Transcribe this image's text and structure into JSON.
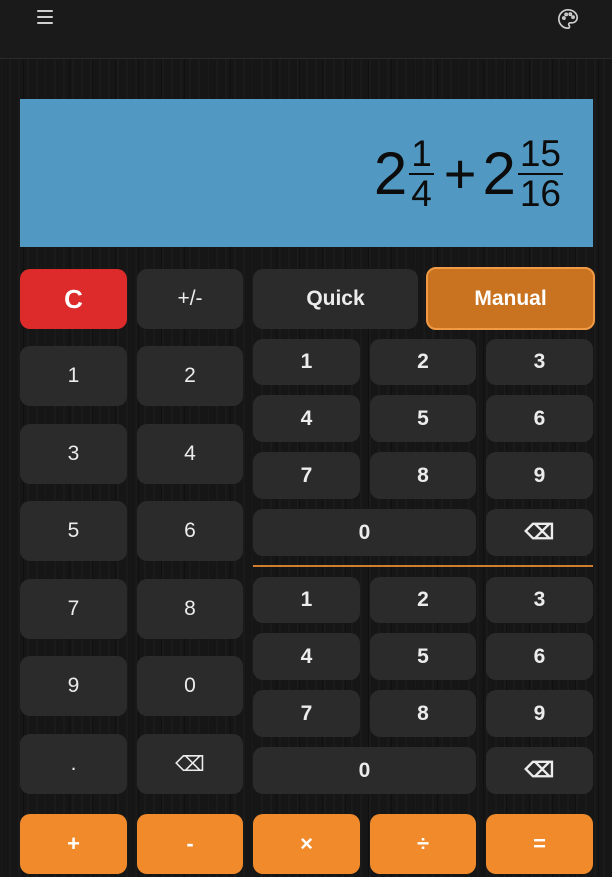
{
  "header": {
    "menu_icon": "hamburger-menu-icon",
    "palette_icon": "palette-icon"
  },
  "display": {
    "term1": {
      "whole": "2",
      "numerator": "1",
      "denominator": "4"
    },
    "operator": "+",
    "term2": {
      "whole": "2",
      "numerator": "15",
      "denominator": "16"
    }
  },
  "left_keys": {
    "clear": "C",
    "sign": "+/-",
    "digits": [
      "1",
      "2",
      "3",
      "4",
      "5",
      "6",
      "7",
      "8",
      "9",
      "0"
    ],
    "decimal": ".",
    "backspace": "⌫"
  },
  "mode": {
    "quick": "Quick",
    "manual": "Manual",
    "active": "Manual"
  },
  "numerator_pad": {
    "digits": [
      "1",
      "2",
      "3",
      "4",
      "5",
      "6",
      "7",
      "8",
      "9",
      "0"
    ],
    "backspace": "⌫"
  },
  "denominator_pad": {
    "digits": [
      "1",
      "2",
      "3",
      "4",
      "5",
      "6",
      "7",
      "8",
      "9",
      "0"
    ],
    "backspace": "⌫"
  },
  "operators": {
    "add": "+",
    "subtract": "-",
    "multiply": "×",
    "divide": "÷",
    "equals": "="
  },
  "colors": {
    "display": "#5199c3",
    "clear": "#dd2a2a",
    "accent": "#f08a2a",
    "manual": "#c9721f",
    "key": "#2b2b2b"
  }
}
